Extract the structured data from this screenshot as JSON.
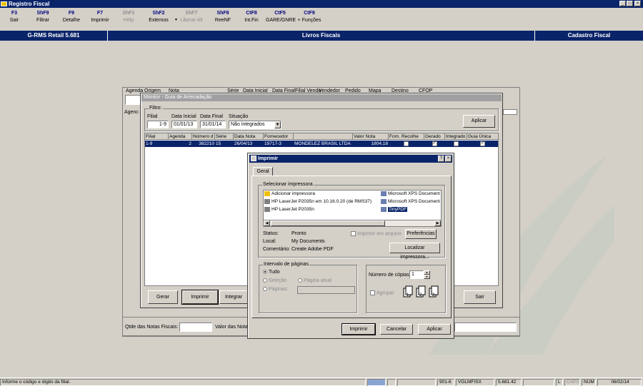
{
  "window": {
    "title": "Registro Fiscal",
    "min": "_",
    "max": "□",
    "close": "×"
  },
  "fkeys": [
    {
      "key": "F3",
      "label": "Sair",
      "enabled": true
    },
    {
      "key": "ShF9",
      "label": "Filtrar",
      "enabled": true
    },
    {
      "key": "F9",
      "label": "Detalhe",
      "enabled": true
    },
    {
      "key": "F7",
      "label": "Imprimir",
      "enabled": true
    },
    {
      "key": "ShF1",
      "label": "Help",
      "enabled": false
    },
    {
      "key": "ShF2",
      "label": "Externos",
      "enabled": true
    },
    {
      "key": "ShF7",
      "label": "Liberar Alt",
      "enabled": false
    },
    {
      "key": "ShF8",
      "label": "ReeNF",
      "enabled": true
    },
    {
      "key": "CtF8",
      "label": "Int.Fin",
      "enabled": true
    },
    {
      "key": "CtF5",
      "label": "GARE/GNRE",
      "enabled": true
    },
    {
      "key": "CtF9",
      "label": "+ Funções",
      "enabled": true
    }
  ],
  "header": {
    "left": "G-RMS Retail 5.681",
    "center": "Livros Fiscais",
    "right": "Cadastro Fiscal"
  },
  "bg": {
    "cols": [
      "Agenda",
      "Origem",
      "Nota",
      "Série",
      "Data Inicial",
      "Data Final",
      "Filial Venda",
      "Vendedor",
      "Pedido",
      "Mapa",
      "Destino",
      "CFOP"
    ],
    "side": "Agenc",
    "qtde_label": "Qtde das Notas Fiscais:",
    "valor_label": "Valor  das Nota"
  },
  "monitor": {
    "title": "Monitor - Guia de Arrecadação",
    "filtro": "Filtro:",
    "filial_label": "Filial",
    "filial": "1-9",
    "di_label": "Data Inicial",
    "di": "01/01/13",
    "df_label": "Data Final",
    "df": "31/01/14",
    "sit_label": "Situação",
    "sit": "Não integrados",
    "aplicar": "Aplicar",
    "cols": [
      "Filial",
      "Agenda",
      "Número d",
      "Série",
      "Data Nota",
      "Fornecedor",
      "",
      "Valor Nota",
      "Forn. Recolhe",
      "Gerado",
      "Integrado",
      "Guia Única"
    ],
    "row": [
      "1-9",
      "2",
      "382210",
      "15",
      "26/04/13",
      "19717-3",
      "MONDELEZ BRASIL LTDA",
      "1804,18"
    ],
    "btn_gerar": "Gerar",
    "btn_imprimir": "Imprimir",
    "btn_integrar": "Integrar",
    "btn_sair": "Sair"
  },
  "print": {
    "title": "Imprimir",
    "help": "?",
    "close": "×",
    "tab": "Geral",
    "sel_label": "Selecionar impressora",
    "printers_left": [
      "Adicionar impressora",
      "HP LaserJet P2035n em 10.16.0.20 (de RMS37)",
      "HP LaserJet P2035n"
    ],
    "printers_right": [
      "Microsoft XPS Document",
      "Microsoft XPS Document",
      "TinyPDF"
    ],
    "status_l": "Status:",
    "status_v": "Pronto",
    "local_l": "Local:",
    "local_v": "My Documents",
    "coment_l": "Comentário:",
    "coment_v": "Create Adobe PDF",
    "arquivo": "Imprimir em arquivo",
    "pref": "Preferências",
    "localizar": "Localizar impressora...",
    "interval_label": "Intervalo de páginas",
    "tudo": "Tudo",
    "selecao": "Seleção",
    "pag_atual": "Página atual",
    "paginas": "Páginas:",
    "copias_label": "Número de cópias:",
    "copias": "1",
    "agrupar": "Agrupar",
    "btn_imprimir": "Imprimir",
    "btn_cancelar": "Cancelar",
    "btn_aplicar": "Aplicar"
  },
  "statusbar": {
    "msg": "Informe o código e dígito da filial.",
    "code": "901-6",
    "user": "VGLMFISX",
    "ver": "5.681.42",
    "l": "L",
    "caps": "CAPS",
    "num": "NUM",
    "date": "06/02/14"
  }
}
